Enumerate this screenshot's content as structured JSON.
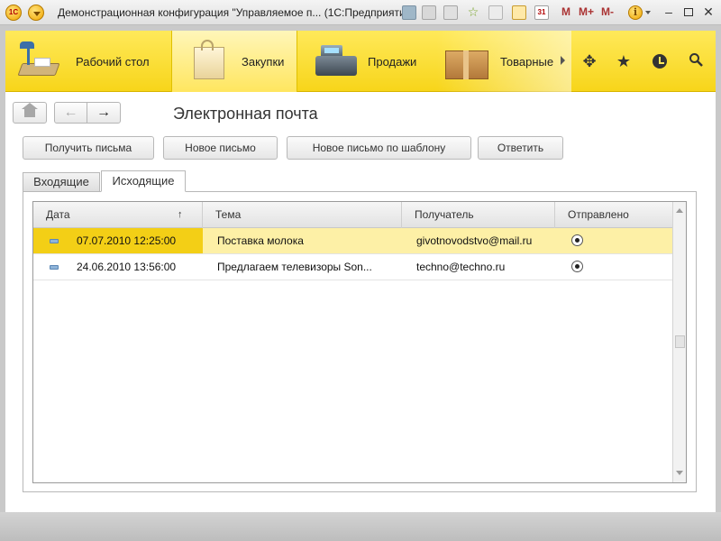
{
  "window": {
    "logo_text": "1С",
    "title": "Демонстрационная конфигурация \"Управляемое п...  (1С:Предприятие)",
    "mem_m": "M",
    "mem_mplus": "M+",
    "mem_mminus": "M-",
    "info": "i"
  },
  "sections": {
    "items": [
      {
        "label": "Рабочий стол",
        "icon": "desk-lamp-icon"
      },
      {
        "label": "Закупки",
        "icon": "shopping-bag-icon",
        "active": true
      },
      {
        "label": "Продажи",
        "icon": "cash-register-icon"
      },
      {
        "label": "Товарные",
        "icon": "cardboard-box-icon"
      }
    ],
    "tools": [
      "all-functions-icon",
      "favorites-star-icon",
      "history-icon",
      "search-icon"
    ]
  },
  "page": {
    "title": "Электронная почта"
  },
  "toolbar": {
    "get_mail": "Получить письма",
    "new_mail": "Новое письмо",
    "new_from_template": "Новое письмо по шаблону",
    "reply": "Ответить"
  },
  "tabs": {
    "inbox": "Входящие",
    "outbox": "Исходящие",
    "active": "outbox"
  },
  "table": {
    "columns": {
      "date": "Дата",
      "subject": "Тема",
      "recipient": "Получатель",
      "sent": "Отправлено"
    },
    "sort_indicator": "↑",
    "rows": [
      {
        "date": "07.07.2010 12:25:00",
        "subject": "Поставка молока",
        "recipient": "givotnovodstvo@mail.ru",
        "sent": true,
        "selected": true
      },
      {
        "date": "24.06.2010 13:56:00",
        "subject": "Предлагаем телевизоры Son...",
        "recipient": "techno@techno.ru",
        "sent": true,
        "selected": false
      }
    ]
  },
  "colors": {
    "section_panel": "#f7d51a",
    "selected_row": "#fdf0a6",
    "selected_cell": "#f3cf16"
  }
}
